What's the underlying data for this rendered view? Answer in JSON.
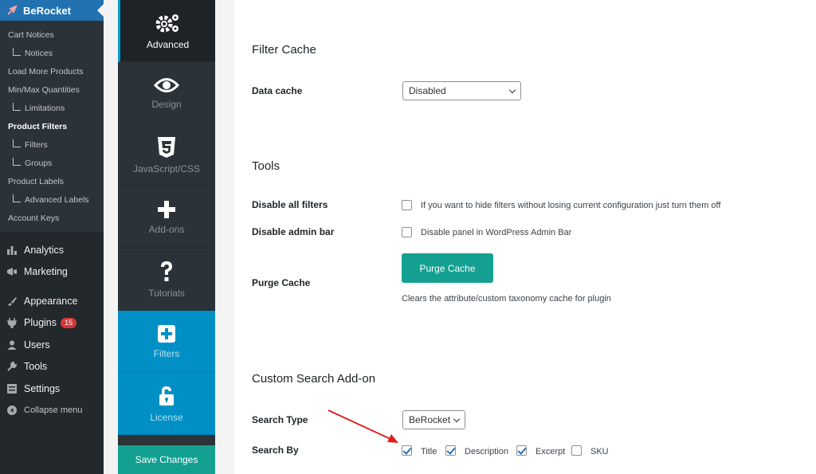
{
  "wp_menu": {
    "brand": "BeRocket",
    "submenu": [
      {
        "label": "Cart Notices",
        "child": false,
        "current": false
      },
      {
        "label": "Notices",
        "child": true,
        "current": false
      },
      {
        "label": "Load More Products",
        "child": false,
        "current": false
      },
      {
        "label": "Min/Max Quantities",
        "child": false,
        "current": false
      },
      {
        "label": "Limitations",
        "child": true,
        "current": false
      },
      {
        "label": "Product Filters",
        "child": false,
        "current": true
      },
      {
        "label": "Filters",
        "child": true,
        "current": false
      },
      {
        "label": "Groups",
        "child": true,
        "current": false
      },
      {
        "label": "Product Labels",
        "child": false,
        "current": false
      },
      {
        "label": "Advanced Labels",
        "child": true,
        "current": false
      },
      {
        "label": "Account Keys",
        "child": false,
        "current": false
      }
    ],
    "analytics": "Analytics",
    "marketing": "Marketing",
    "appearance": "Appearance",
    "plugins": "Plugins",
    "plugins_badge": "15",
    "users": "Users",
    "tools": "Tools",
    "settings": "Settings",
    "collapse": "Collapse menu"
  },
  "tabs": {
    "advanced": "Advanced",
    "design": "Design",
    "jscss": "JavaScript/CSS",
    "addons": "Add-ons",
    "tutorials": "Tutorials",
    "filters": "Filters",
    "license": "License",
    "save": "Save Changes"
  },
  "content": {
    "filter_cache": {
      "heading": "Filter Cache",
      "data_cache_label": "Data cache",
      "data_cache_value": "Disabled"
    },
    "tools": {
      "heading": "Tools",
      "disable_filters_label": "Disable all filters",
      "disable_filters_text": "If you want to hide filters without losing current configuration just turn them off",
      "disable_filters_checked": false,
      "disable_admin_bar_label": "Disable admin bar",
      "disable_admin_bar_text": "Disable panel in WordPress Admin Bar",
      "disable_admin_bar_checked": false,
      "purge_label": "Purge Cache",
      "purge_button": "Purge Cache",
      "purge_desc": "Clears the attribute/custom taxonomy cache for plugin"
    },
    "search": {
      "heading": "Custom Search Add-on",
      "search_type_label": "Search Type",
      "search_type_value": "BeRocket",
      "search_by_label": "Search By",
      "options": [
        {
          "label": "Title",
          "checked": true
        },
        {
          "label": "Description",
          "checked": true
        },
        {
          "label": "Excerpt",
          "checked": true
        },
        {
          "label": "SKU",
          "checked": false
        }
      ]
    }
  },
  "colors": {
    "wp_blue": "#2271b1",
    "teal": "#13a091",
    "tab_blue": "#0090c6",
    "arrow_red": "#e02020"
  }
}
